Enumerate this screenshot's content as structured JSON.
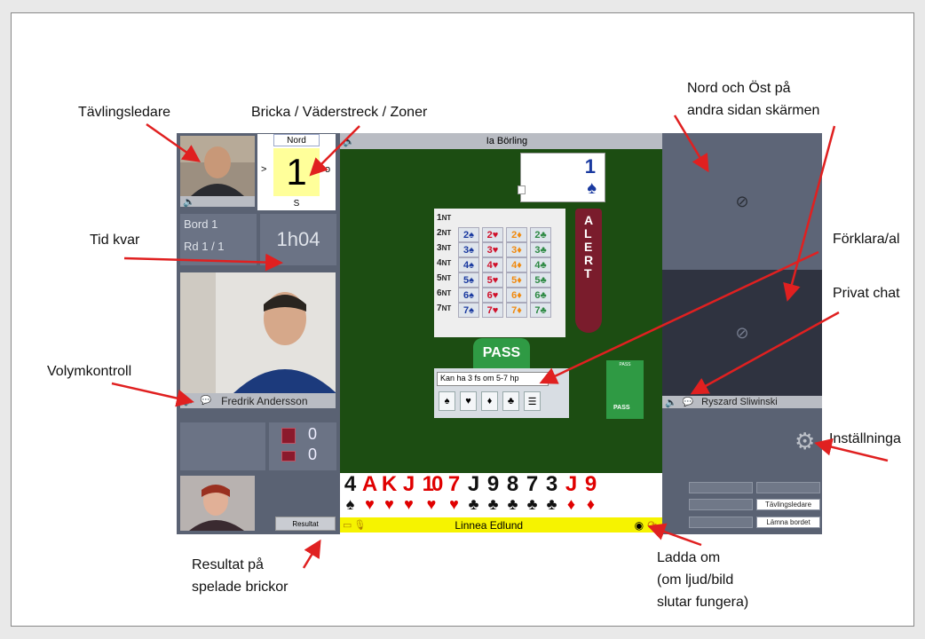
{
  "annotations": {
    "director": "Tävlingsledare",
    "board_info": "Bricka / Väderstreck / Zoner",
    "north_east": [
      "Nord och Öst på",
      "andra sidan skärmen"
    ],
    "time_left": "Tid kvar",
    "explain_alert": "Förklara/al",
    "private_chat": "Privat chat",
    "volume": "Volymkontroll",
    "settings": "Inställninga",
    "results": [
      "Resultat på",
      "spelade brickor"
    ],
    "reload": [
      "Ladda om",
      "(om ljud/bild",
      "slutar fungera)"
    ]
  },
  "compass": {
    "north": "Nord",
    "south": "S",
    "west": ">",
    "east": "o",
    "board_number": "1"
  },
  "table": {
    "board": "Bord 1",
    "round": "Rd 1 / 1",
    "time": "1h04"
  },
  "players": {
    "west": "Fredrik Andersson",
    "north_top": "Ia Börling",
    "south": "Linnea Edlund",
    "east": "Ryszard Sliwinski"
  },
  "score": {
    "ns": "0",
    "ew": "0"
  },
  "buttons": {
    "results": "Resultat",
    "pass": "PASS",
    "alert": "ALERT",
    "right_small_pass": "PASS"
  },
  "bidding_box": {
    "levels": [
      "1",
      "2",
      "3",
      "4",
      "5",
      "6",
      "7"
    ],
    "nt_suffix": "NT",
    "rows": [
      [
        "2♠",
        "2♥",
        "2♦",
        "2♣"
      ],
      [
        "3♠",
        "3♥",
        "3♦",
        "3♣"
      ],
      [
        "4♠",
        "4♥",
        "4♦",
        "4♣"
      ],
      [
        "5♠",
        "5♥",
        "5♦",
        "5♣"
      ],
      [
        "6♠",
        "6♥",
        "6♦",
        "6♣"
      ],
      [
        "7♠",
        "7♥",
        "7♦",
        "7♣"
      ]
    ],
    "explain_text": "Kan ha 3 fs om 5-7 hp",
    "suit_buttons": [
      "♠",
      "♥",
      "♦",
      "♣",
      "☰"
    ]
  },
  "contract_card": {
    "level": "1",
    "suit": "♠"
  },
  "hand": [
    {
      "rank": "4",
      "suit": "♠",
      "color": "#111111"
    },
    {
      "rank": "A",
      "suit": "♥",
      "color": "#e00000"
    },
    {
      "rank": "K",
      "suit": "♥",
      "color": "#e00000"
    },
    {
      "rank": "J",
      "suit": "♥",
      "color": "#e00000"
    },
    {
      "rank": "10",
      "suit": "♥",
      "color": "#e00000"
    },
    {
      "rank": "7",
      "suit": "♥",
      "color": "#e00000"
    },
    {
      "rank": "J",
      "suit": "♣",
      "color": "#111111"
    },
    {
      "rank": "9",
      "suit": "♣",
      "color": "#111111"
    },
    {
      "rank": "8",
      "suit": "♣",
      "color": "#111111"
    },
    {
      "rank": "7",
      "suit": "♣",
      "color": "#111111"
    },
    {
      "rank": "3",
      "suit": "♣",
      "color": "#111111"
    },
    {
      "rank": "J",
      "suit": "♦",
      "color": "#e00000"
    },
    {
      "rank": "9",
      "suit": "♦",
      "color": "#e00000"
    }
  ],
  "right_panel_buttons": [
    "Tävlingsledare",
    "Lämna bordet"
  ],
  "icons": [
    "speaker-icon",
    "chat-icon",
    "camera-off-icon",
    "gear-icon",
    "eye-icon",
    "reload-icon",
    "microphone-icon",
    "video-icon"
  ],
  "colors": {
    "felt": "#1c4d12",
    "panel": "#5a6273",
    "tile": "#6b7385",
    "alert": "#7a1c2c",
    "pass": "#2f9a44",
    "name_bar_yellow": "#f6f300",
    "arrow": "#e02020"
  }
}
